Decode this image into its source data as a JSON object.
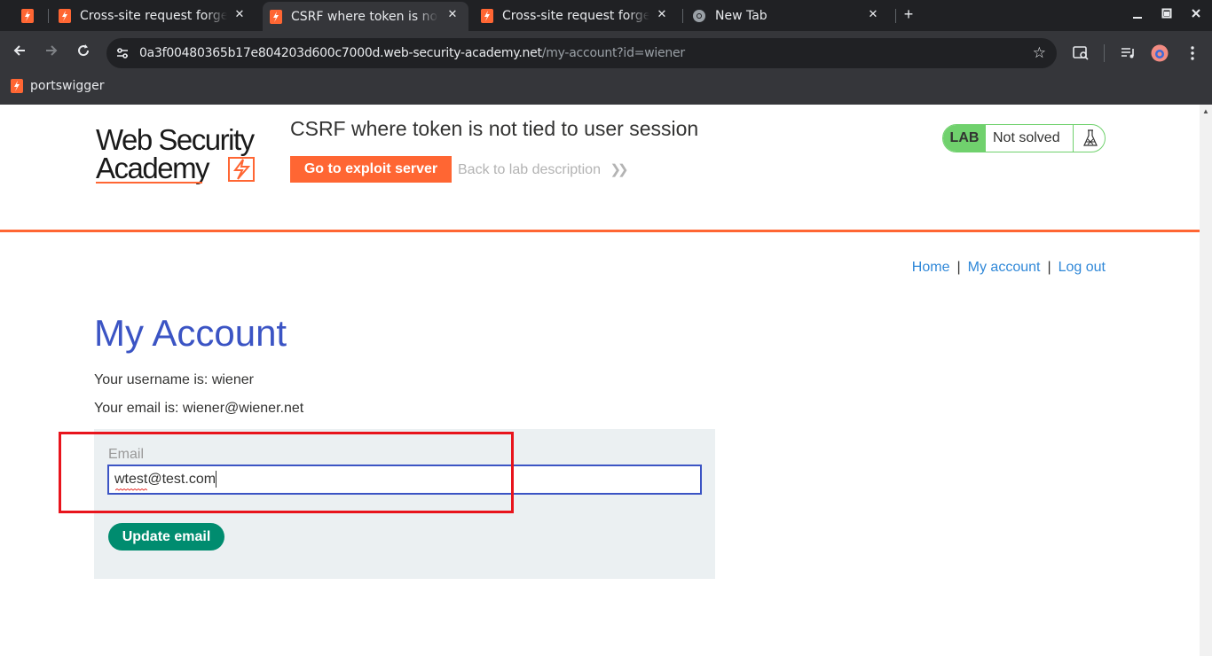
{
  "browser": {
    "tabs": [
      {
        "title": "",
        "active": false
      },
      {
        "title": "Cross-site request forgery",
        "active": false
      },
      {
        "title": "CSRF where token is not tied",
        "active": true
      },
      {
        "title": "Cross-site request forgery",
        "active": false
      },
      {
        "title": "New Tab",
        "active": false
      }
    ],
    "new_tab_symbol": "+",
    "url_host": "0a3f00480365b17e804203d600c7000d.web-security-academy.net",
    "url_path": "/my-account?id=wiener",
    "bookmark": "portswigger"
  },
  "header": {
    "logo_line1": "Web Security",
    "logo_line2": "Academy",
    "lab_title": "CSRF where token is not tied to user session",
    "exploit_button": "Go to exploit server",
    "back_link": "Back to lab description",
    "lab_badge": "LAB",
    "lab_state": "Not solved"
  },
  "nav": {
    "home": "Home",
    "separator": "|",
    "my_account": "My account",
    "log_out": "Log out"
  },
  "account": {
    "heading": "My Account",
    "username_line": "Your username is: wiener",
    "email_line": "Your email is: wiener@wiener.net",
    "email_label": "Email",
    "email_value": "wtest@test.com",
    "update_button": "Update email"
  },
  "colors": {
    "brand_orange": "#ff6633",
    "heading_blue": "#3b54c4",
    "link_blue": "#3088d8",
    "lab_green": "#70d16d",
    "button_green": "#008c6f",
    "annotation_red": "#e8141c"
  }
}
